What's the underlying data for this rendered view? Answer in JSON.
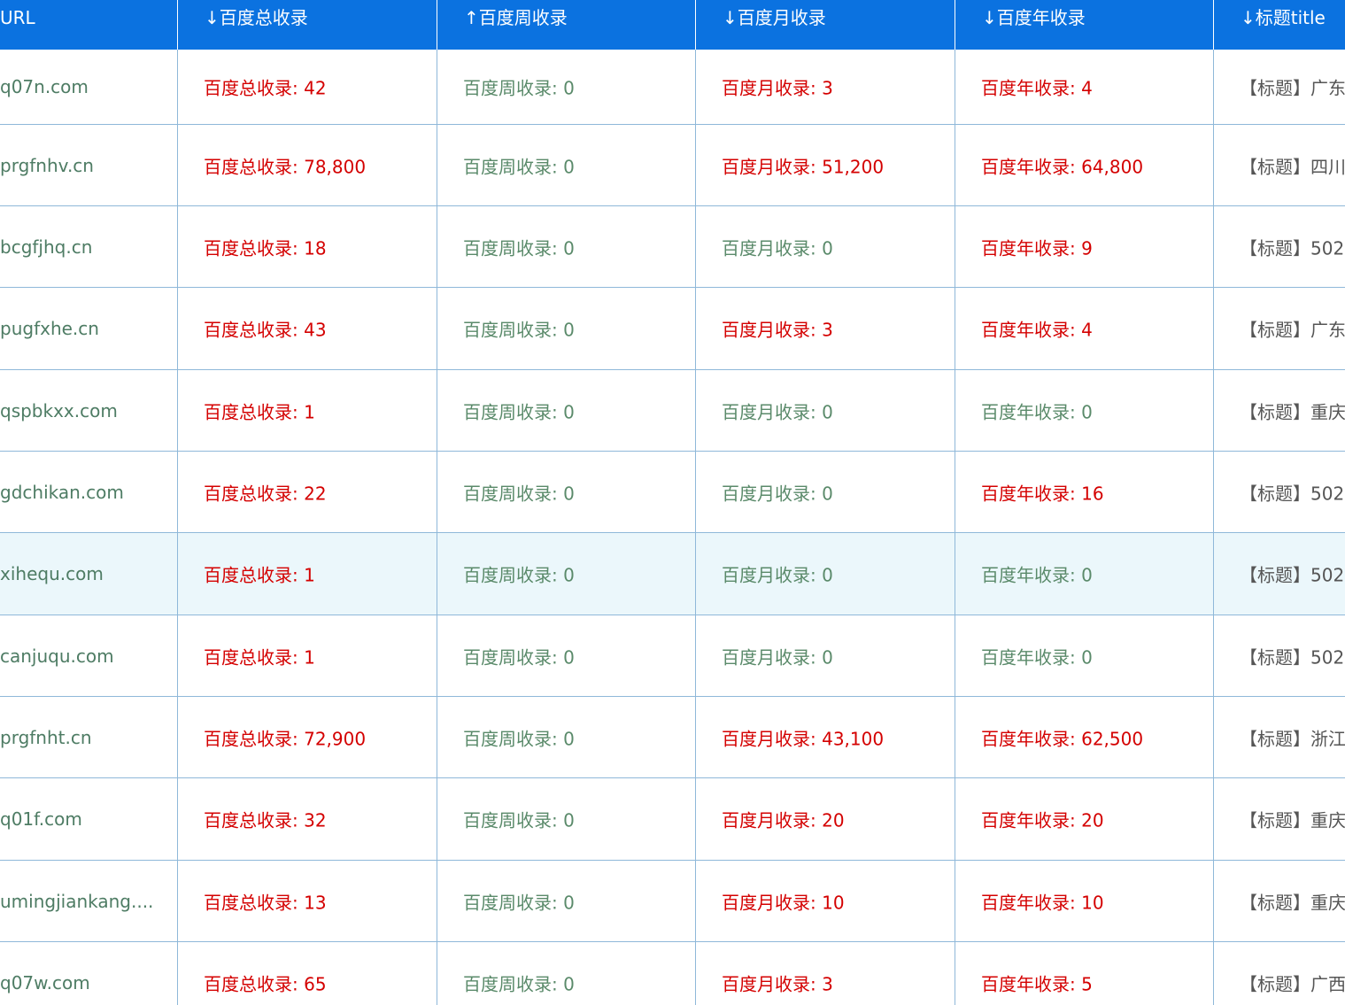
{
  "headers": [
    "URL",
    "↓百度总收录",
    "↑百度周收录",
    "↓百度月收录",
    "↓百度年收录",
    "↓标题title"
  ],
  "rows": [
    {
      "url": "q07n.com",
      "total": "百度总收录: 42",
      "week": "百度周收录: 0",
      "month": "百度月收录: 3",
      "year": "百度年收录: 4",
      "title": "【标题】广东"
    },
    {
      "url": "prgfnhv.cn",
      "total": "百度总收录: 78,800",
      "week": "百度周收录: 0",
      "month": "百度月收录: 51,200",
      "year": "百度年收录: 64,800",
      "title": "【标题】四川"
    },
    {
      "url": "bcgfjhq.cn",
      "total": "百度总收录: 18",
      "week": "百度周收录: 0",
      "month": "百度月收录: 0",
      "year": "百度年收录: 9",
      "title": "【标题】502"
    },
    {
      "url": "pugfxhe.cn",
      "total": "百度总收录: 43",
      "week": "百度周收录: 0",
      "month": "百度月收录: 3",
      "year": "百度年收录: 4",
      "title": "【标题】广东"
    },
    {
      "url": "qspbkxx.com",
      "total": "百度总收录: 1",
      "week": "百度周收录: 0",
      "month": "百度月收录: 0",
      "year": "百度年收录: 0",
      "title": "【标题】重庆"
    },
    {
      "url": "gdchikan.com",
      "total": "百度总收录: 22",
      "week": "百度周收录: 0",
      "month": "百度月收录: 0",
      "year": "百度年收录: 16",
      "title": "【标题】502"
    },
    {
      "url": "xihequ.com",
      "total": "百度总收录: 1",
      "week": "百度周收录: 0",
      "month": "百度月收录: 0",
      "year": "百度年收录: 0",
      "title": "【标题】502"
    },
    {
      "url": "canjuqu.com",
      "total": "百度总收录: 1",
      "week": "百度周收录: 0",
      "month": "百度月收录: 0",
      "year": "百度年收录: 0",
      "title": "【标题】502"
    },
    {
      "url": "prgfnht.cn",
      "total": "百度总收录: 72,900",
      "week": "百度周收录: 0",
      "month": "百度月收录: 43,100",
      "year": "百度年收录: 62,500",
      "title": "【标题】浙江"
    },
    {
      "url": "q01f.com",
      "total": "百度总收录: 32",
      "week": "百度周收录: 0",
      "month": "百度月收录: 20",
      "year": "百度年收录: 20",
      "title": "【标题】重庆"
    },
    {
      "url": "umingjiankang....",
      "total": "百度总收录: 13",
      "week": "百度周收录: 0",
      "month": "百度月收录: 10",
      "year": "百度年收录: 10",
      "title": "【标题】重庆"
    },
    {
      "url": "q07w.com",
      "total": "百度总收录: 65",
      "week": "百度周收录: 0",
      "month": "百度月收录: 3",
      "year": "百度年收录: 5",
      "title": "【标题】广西"
    }
  ],
  "colors": {
    "header_bg": "#0b72e0",
    "nonzero_value": "#d40000",
    "zero_value": "#5a8a6a",
    "url_text": "#4e7c64",
    "title_text": "#555555",
    "highlight_row": "#ebf7fb"
  }
}
